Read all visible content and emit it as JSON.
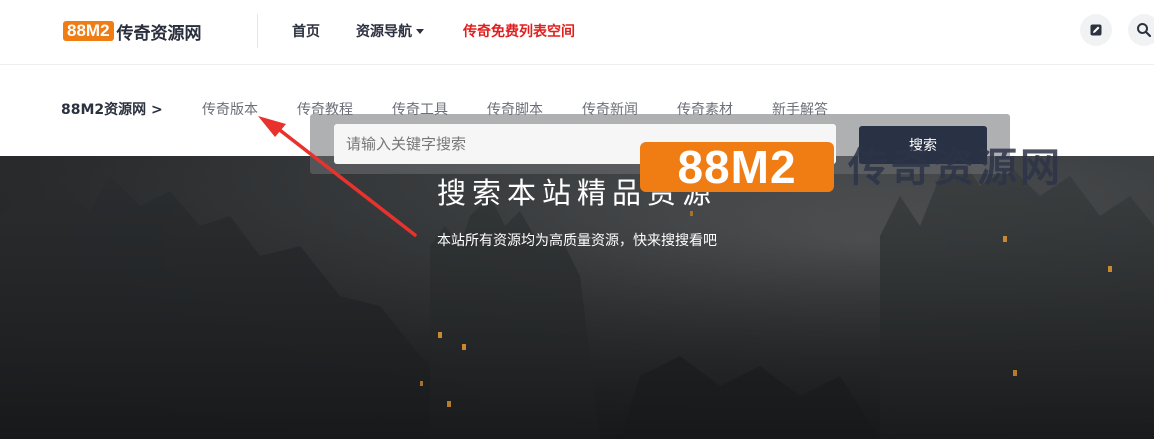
{
  "header": {
    "logo_badge": "88M2",
    "logo_text": "传奇资源网",
    "nav": [
      {
        "label": "首页"
      },
      {
        "label": "资源导航"
      },
      {
        "label": "传奇免费列表空间"
      }
    ],
    "icons": [
      "edit-icon",
      "search-icon"
    ]
  },
  "subnav": {
    "breadcrumb": "88M2资源网 >",
    "items": [
      "传奇版本",
      "传奇教程",
      "传奇工具",
      "传奇脚本",
      "传奇新闻",
      "传奇素材",
      "新手解答"
    ]
  },
  "hero": {
    "title": "搜索本站精品资源",
    "subtitle": "本站所有资源均为高质量资源，快来搜搜看吧",
    "search_placeholder": "请输入关键字搜索",
    "search_button": "搜索"
  },
  "watermark": {
    "badge": "88M2",
    "text": "传奇资源网"
  },
  "colors": {
    "accent_orange": "#f07c14",
    "nav_highlight_red": "#e02020",
    "arrow_red": "#e8322d",
    "dark_navy": "#293244"
  }
}
